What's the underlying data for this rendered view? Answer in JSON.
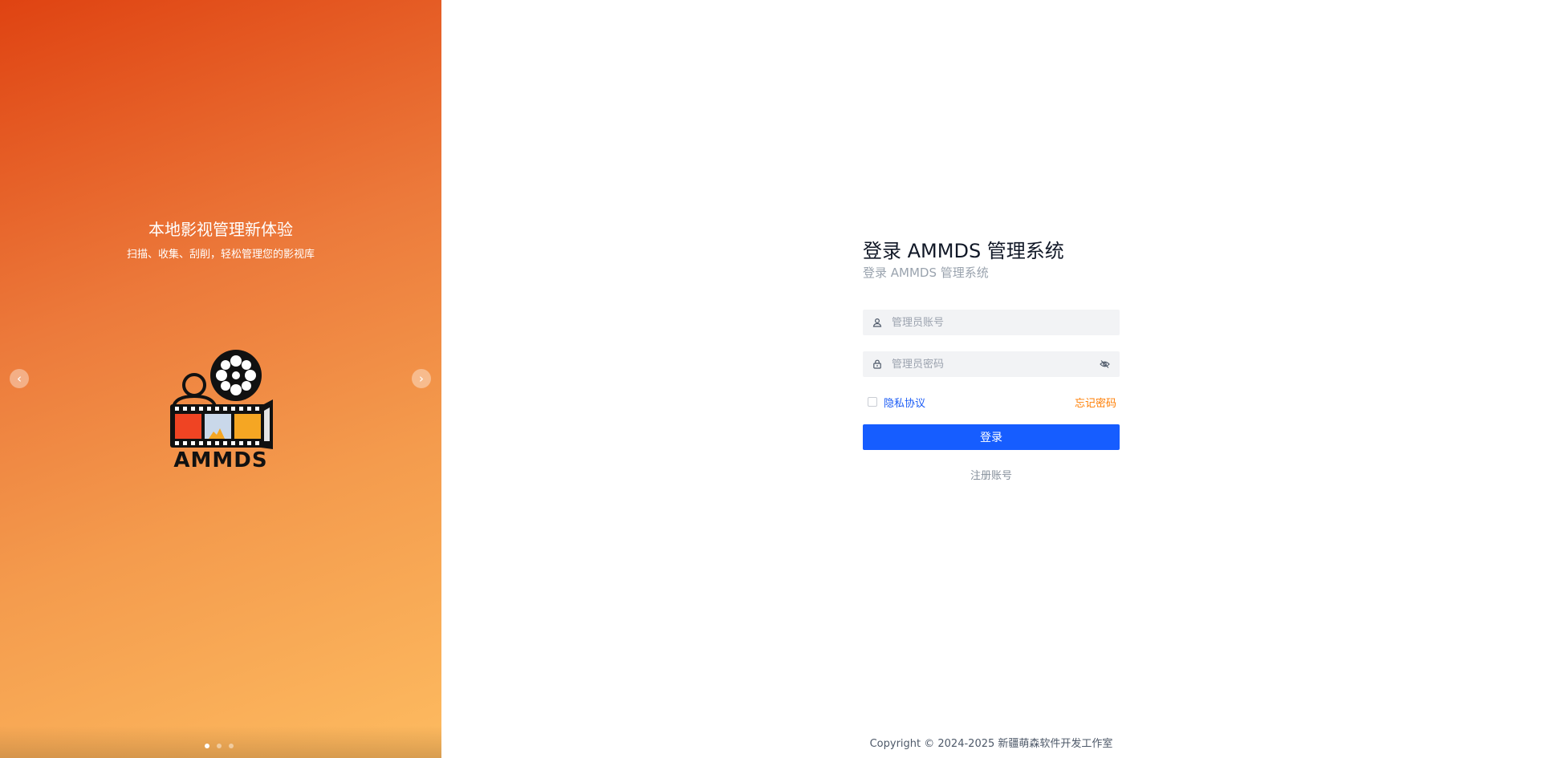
{
  "carousel": {
    "title": "本地影视管理新体验",
    "subtitle": "扫描、收集、刮削，轻松管理您的影视库",
    "prev_icon": "‹",
    "next_icon": "›",
    "active_index": 0,
    "slide_count": 3,
    "logo_text": "AMMDS"
  },
  "login": {
    "title": "登录 AMMDS 管理系统",
    "subtitle": "登录 AMMDS 管理系统",
    "username_placeholder": "管理员账号",
    "password_placeholder": "管理员密码",
    "privacy_label": "隐私协议",
    "forgot_label": "忘记密码",
    "submit_label": "登录",
    "register_label": "注册账号"
  },
  "footer": {
    "copyright": "Copyright © 2024-2025 新疆萌森软件开发工作室"
  },
  "colors": {
    "primary": "#165dff",
    "link": "#1c5cf5",
    "warning": "#ff7d00",
    "panel_top": "#df4312",
    "panel_bottom": "#fdbb60"
  }
}
